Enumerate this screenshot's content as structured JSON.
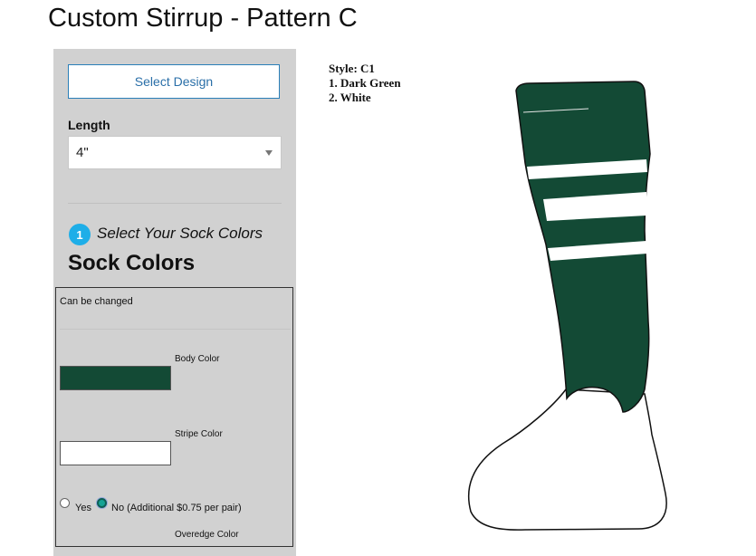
{
  "page": {
    "title": "Custom Stirrup - Pattern C"
  },
  "panel": {
    "select_design_label": "Select Design",
    "length_label": "Length",
    "length_value": "4\"",
    "step_number": "1",
    "step_text": "Select Your Sock Colors",
    "section_title": "Sock Colors",
    "can_be_changed": "Can be changed",
    "body_color_label": "Body Color",
    "body_color": "#134a35",
    "stripe_color_label": "Stripe Color",
    "stripe_color": "#ffffff",
    "overedge": {
      "yes_label": "Yes",
      "no_label": "No (Additional $0.75 per pair)",
      "selected": "No"
    },
    "overedge_color_label": "Overedge Color"
  },
  "style_info": {
    "style": "Style: C1",
    "colors": [
      "1. Dark Green",
      "2. White"
    ]
  },
  "sock": {
    "body_color": "#134a35",
    "stripe_color": "#ffffff",
    "foot_color": "#ffffff"
  }
}
